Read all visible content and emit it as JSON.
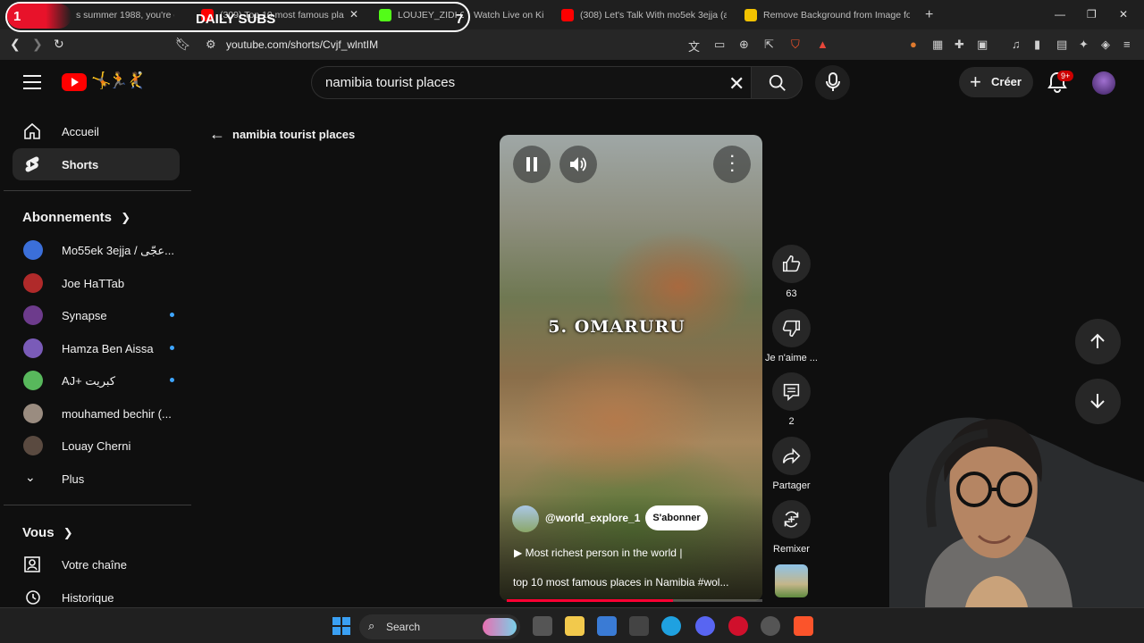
{
  "stream_overlay": {
    "badge": "1",
    "title": "DAILY SUBS",
    "count": "7"
  },
  "browser": {
    "tabs": [
      {
        "label": "s summer 1988, you're dr",
        "color": "#c0392b"
      },
      {
        "label": "(309) Top 10 most famous pla",
        "color": "#ff0000"
      },
      {
        "label": "LOUJEY_ZIDI Ch",
        "color": "#53fc18"
      },
      {
        "label": "Watch Live on Ki",
        "color": "#53fc18"
      },
      {
        "label": "(308) Let's Talk With mo5ek 3ejja (a",
        "color": "#ff0000"
      },
      {
        "label": "Remove Background from Image for",
        "color": "#f2c200"
      }
    ],
    "new_tab": "+",
    "url": "youtube.com/shorts/Cvjf_wlntIM"
  },
  "youtube": {
    "search_query": "namibia tourist places",
    "create_label": "Créer",
    "notif_count": "9+",
    "sidebar": {
      "home": "Accueil",
      "shorts": "Shorts",
      "subscriptions_title": "Abonnements",
      "subscriptions": [
        {
          "name": "Mo55ek 3ejja / عجّى...",
          "live": false,
          "color": "#3b6fd9"
        },
        {
          "name": "Joe HaTTab",
          "live": false,
          "color": "#b02a2a"
        },
        {
          "name": "Synapse",
          "live": true,
          "color": "#6d3b8c"
        },
        {
          "name": "Hamza Ben Aissa",
          "live": true,
          "color": "#7a5bb8"
        },
        {
          "name": "AJ+ كبريت",
          "live": true,
          "color": "#58b85c"
        },
        {
          "name": "mouhamed bechir (...",
          "live": false,
          "color": "#9a8c80"
        },
        {
          "name": "Louay Cherni",
          "live": false,
          "color": "#5a4a40"
        }
      ],
      "more": "Plus",
      "you_title": "Vous",
      "your_channel": "Votre chaîne",
      "history": "Historique"
    },
    "page_title": "namibia tourist places",
    "short": {
      "caption": "5. OMARURU",
      "channel": "@world_explore_1",
      "subscribe": "S'abonner",
      "music": "Most richest person in the world |",
      "title": "top 10 most famous places in Namibia #wol...",
      "progress": 0.65,
      "likes": "63",
      "dislike_label": "Je n'aime ...",
      "comments": "2",
      "share_label": "Partager",
      "remix_label": "Remixer"
    }
  },
  "taskbar": {
    "search_label": "Search"
  }
}
